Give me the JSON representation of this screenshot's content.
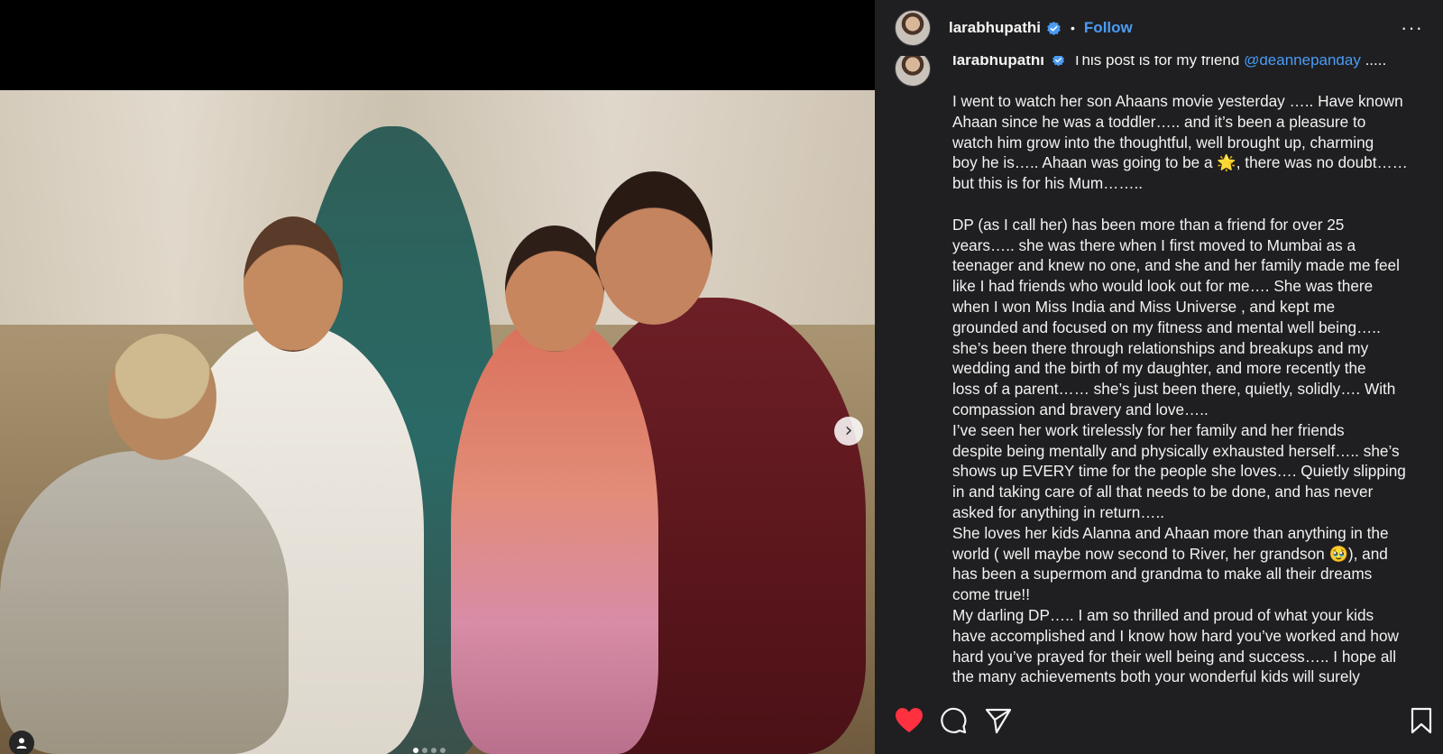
{
  "post": {
    "username": "larabhupathi",
    "follow_label": "Follow",
    "separator": "•",
    "more_label": "···",
    "next_label": "›",
    "caption_username": "larabhupathi",
    "caption_intro": "This post is for my friend",
    "caption_mention": "@deannepanday",
    "caption_intro_end": ".....",
    "caption_lines": [
      "I went to watch her son Ahaans movie yesterday ….. Have known",
      "Ahaan since he was a toddler….. and it’s been a pleasure to",
      "watch him grow into the thoughtful, well brought up, charming",
      "boy he is….. Ahaan was going to be a 🌟, there was no doubt……",
      "but this is for his Mum……..",
      "",
      "DP (as I call her) has been more than a friend for over 25",
      "years….. she was there when I first moved to Mumbai as a",
      "teenager and knew no one, and she and her family made me feel",
      "like I had friends who would look out for me…. She was there",
      "when I won Miss India and Miss Universe , and kept me",
      "grounded and focused on my fitness and mental well being…..",
      "she’s been there through relationships and breakups and my",
      "wedding and the birth of my daughter, and more recently the",
      "loss of a parent…… she’s just been there, quietly, solidly…. With",
      "compassion and bravery and love…..",
      "I’ve seen her work tirelessly for her family and her friends",
      "despite being mentally and physically exhausted herself….. she’s",
      "shows up EVERY time for the people she loves…. Quietly slipping",
      "in and taking care of all that needs to be done, and has never",
      "asked for anything in return…..",
      "She loves her kids Alanna and Ahaan more than anything in the",
      "world ( well maybe now second to River, her grandson 🥹), and",
      "has been a supermom and grandma to make all their dreams",
      "come true!!",
      "My darling DP….. I am so thrilled and proud of what your kids",
      "have accomplished and I know how hard you’ve worked and how",
      "hard you’ve prayed for their well being and success….. I hope all",
      "the many achievements both your wonderful kids will surely"
    ]
  },
  "carousel": {
    "count": 4,
    "active": 0
  },
  "icons": {
    "like": "heart-icon",
    "comment": "comment-icon",
    "share": "send-icon",
    "save": "bookmark-icon",
    "verified": "verified-badge-icon",
    "user_tag": "user-tag-icon"
  },
  "colors": {
    "panel_bg": "#1f1f21",
    "accent": "#4a9cf5",
    "like": "#ff3040",
    "text": "#f5f5f5"
  }
}
